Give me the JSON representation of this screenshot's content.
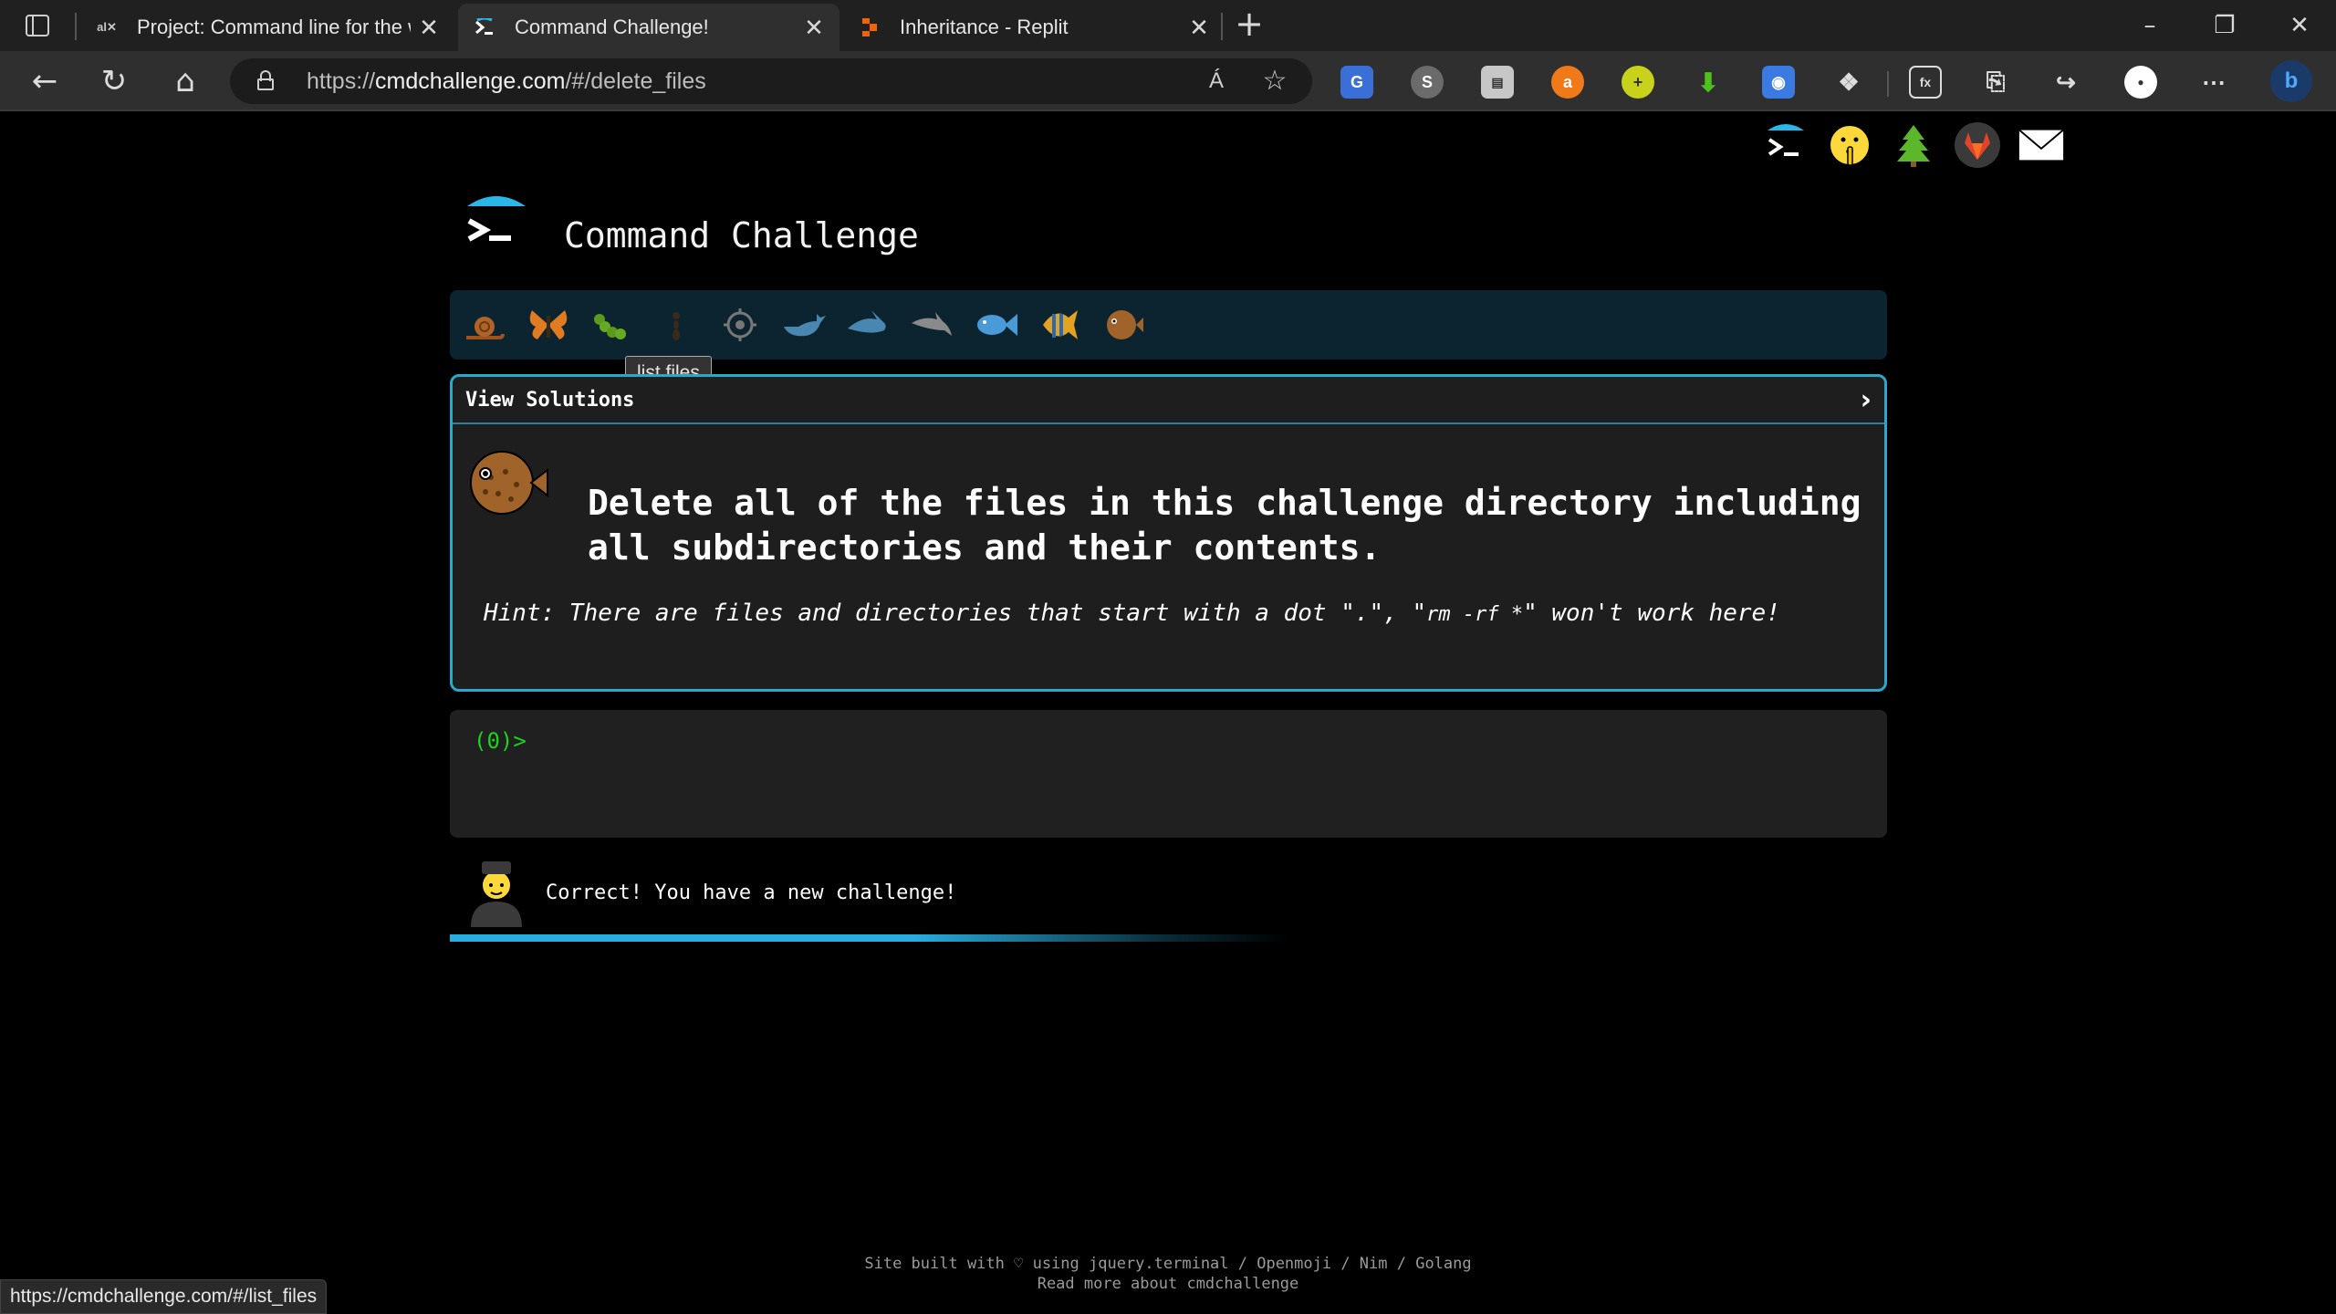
{
  "browser": {
    "tabs": [
      {
        "title": "Project: Command line for the wi",
        "favicon": "alx",
        "active": false
      },
      {
        "title": "Command Challenge!",
        "favicon": "terminal-icon",
        "active": true
      },
      {
        "title": "Inheritance - Replit",
        "favicon": "replit-icon",
        "active": false
      }
    ],
    "url_prefix": "https://",
    "url_host": "cmdchallenge.com",
    "url_path": "/#/delete_files",
    "read_aloud_label": "Á",
    "status_url": "https://cmdchallenge.com/#/list_files"
  },
  "page": {
    "site_title": "Command Challenge",
    "tooltip": "list files",
    "view_solutions": "View Solutions",
    "chevron": "›",
    "challenge_text": "Delete all of the files in this challenge directory including all subdirectories and their contents.",
    "hint_prefix": "Hint: There are files and directories that start with a dot \".\", \"",
    "hint_code": "rm -rf *",
    "hint_suffix": "\" won't work here!",
    "prompt": "(0)>",
    "feedback": "Correct! You have a new challenge!",
    "progress_fraction": 0.55,
    "footer_line1": "Site built with ♡ using jquery.terminal / Openmoji / Nim / Golang",
    "footer_line2": "Read more about cmdchallenge"
  },
  "colors": {
    "accent": "#29a8c9",
    "prompt_green": "#1cd41c",
    "bar_bg": "#0c2430"
  },
  "top_icons": [
    "terminal-logo-icon",
    "shushing-face-icon",
    "tree-icon",
    "gitlab-icon",
    "envelope-icon"
  ],
  "challenge_icons": [
    "snail-icon",
    "butterfly-icon",
    "caterpillar-icon",
    "ant-icon",
    "microbe-icon",
    "whale-icon",
    "shark-icon",
    "dolphin-icon",
    "fish-icon",
    "tropical-fish-icon",
    "blowfish-icon"
  ]
}
